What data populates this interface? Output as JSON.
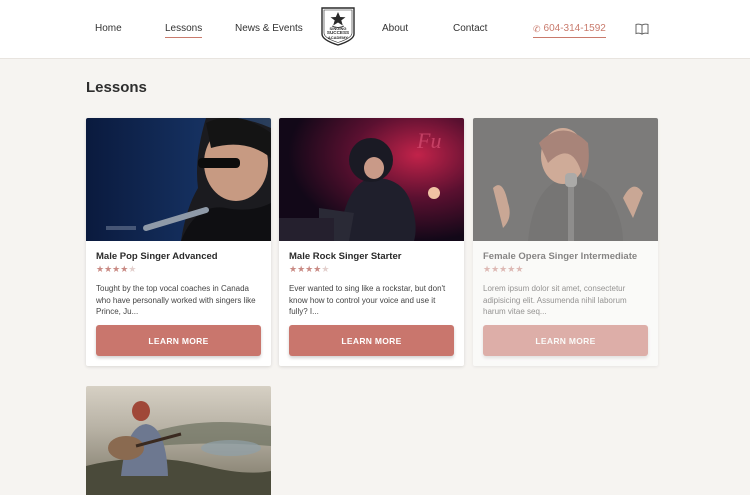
{
  "nav": {
    "home": "Home",
    "lessons": "Lessons",
    "news": "News & Events",
    "about": "About",
    "contact": "Contact",
    "phone": "604-314-1592",
    "phone_icon": "phone-icon",
    "book_icon": "book-icon"
  },
  "logo": {
    "line1": "SINGING",
    "line2": "SUCCESS",
    "line3": "ACADEMY"
  },
  "page": {
    "title": "Lessons"
  },
  "colors": {
    "accent": "#c9766d",
    "star": "#c98a84",
    "background": "#f6f4f1"
  },
  "lessons": [
    {
      "title": "Male Pop Singer Advanced",
      "rating": 4,
      "max_rating": 5,
      "description": "Tought by the top vocal coaches in Canada who have personally worked with singers like Prince, Ju...",
      "button": "LEARN MORE"
    },
    {
      "title": "Male Rock Singer Starter",
      "rating": 4,
      "max_rating": 5,
      "description": "Ever wanted to sing like a rockstar, but don't know how to control your voice and use it fully? I...",
      "button": "LEARN MORE"
    },
    {
      "title": "Female Opera Singer Intermediate",
      "rating": 5,
      "max_rating": 5,
      "description": "Lorem ipsum dolor sit amet, consectetur adipisicing elit. Assumenda nihil laborum harum vitae seq...",
      "button": "LEARN MORE"
    }
  ]
}
